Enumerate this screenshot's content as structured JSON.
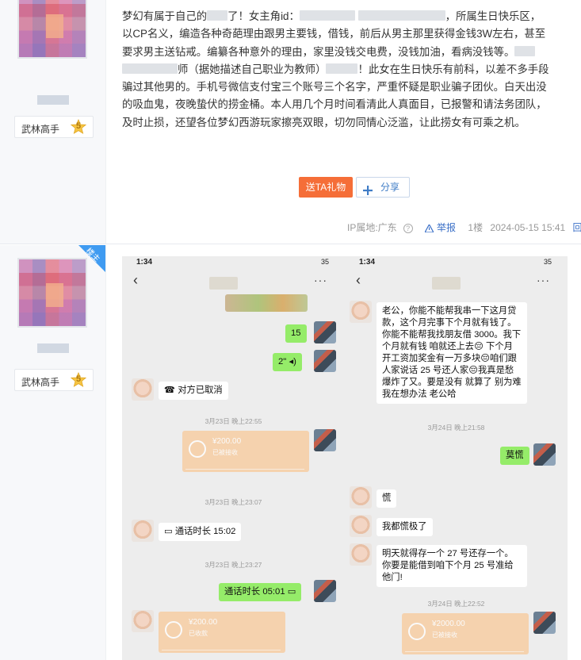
{
  "post1": {
    "user": {
      "badge_label": "武林高手",
      "level": "5"
    },
    "paragraph": "梦幻有属于自己的 了！女主角id： ，所属生日快乐区，以CP名义，编造各种奇葩理由跟男主要钱，借钱，前后从男主那里获得金钱3W左右，甚至要求男主送钻戒。编纂各种意外的理由，家里没钱交电费，没钱加油，看病没钱等。 师（据她描述自己职业为教师） ！此女在生日快乐有前科，以差不多手段骗过其他男的。手机号微信支付宝三个账号三个名字，严重怀疑是职业骗子团伙。白天出没的吸血鬼，夜晚蛰伏的捞金桶。本人用几个月时间看清此人真面目，已报警和请法务团队，及时止损，还望各位梦幻西游玩家擦亮双眼，切勿同情心泛滥，让此捞女有可乘之机。",
    "text": {
      "l1a": "梦幻有属于自己的",
      "l1b": "了！女主角id：",
      "l1c": "，所属生日快乐区，",
      "l2": "以CP名义，编造各种奇葩理由跟男主要钱，借钱，前后从男主那里获得金钱3W左右，甚至",
      "l3": "要求男主送钻戒。编纂各种意外的理由，家里没钱交电费，没钱加油，看病没钱等。",
      "l4a": "师（据她描述自己职业为教师）",
      "l4b": "！此女在生日快乐有前科，以差不多手段",
      "l5": "骗过其他男的。手机号微信支付宝三个账号三个名字，严重怀疑是职业骗子团伙。白天出没",
      "l6": "的吸血鬼，夜晚蛰伏的捞金桶。本人用几个月时间看清此人真面目，已报警和请法务团队，",
      "l7": "及时止损，还望各位梦幻西游玩家擦亮双眼，切勿同情心泛滥，让此捞女有可乘之机。"
    },
    "gift_button": "送TA礼物",
    "share_button": "分享",
    "meta": {
      "ip": "IP属地:广东",
      "report": "举报",
      "floor": "1楼",
      "datetime": "2024-05-15 15:41",
      "reply": "回复"
    }
  },
  "post2": {
    "user": {
      "badge_label": "武林高手",
      "level": "5",
      "corner_tag": "楼主"
    },
    "left_chat": {
      "status_time": "1:34",
      "battery": "35",
      "msg_15": "15",
      "msg_voice": "2\"",
      "msg_cancel": "对方已取消",
      "ts1": "3月23日 晚上22:55",
      "pay1_amount": "¥200.00",
      "pay1_status": "已被接收",
      "ts2": "3月23日 晚上23:07",
      "call1": "通话时长 15:02",
      "ts3": "3月23日 晚上23:27",
      "call2": "通话时长 05:01",
      "pay2_amount": "¥200.00",
      "pay2_status": "已收款"
    },
    "right_chat": {
      "status_time": "1:34",
      "battery": "35",
      "msg_long": "老公，你能不能帮我串一下这月贷款，这个月完事下个月就有钱了。你能不能帮我找朋友借 3000。我下个月就有钱 咱就还上去😔 下个月开工资加奖金有一万多块😔咱们跟人家说话 25 号还人家😔我真是愁爆炸了又。要是没有 就算了 别为难 我在想办法 老公哈",
      "ts1": "3月24日 晚上21:58",
      "msg_reply": "莫慌",
      "msg_huang": "慌",
      "msg_huangji": "我都慌极了",
      "msg_27": "明天就得存一个 27 号还存一个。你要是能借到咱下个月 25 号准给他门!",
      "ts2": "3月24日 晚上22:52",
      "pay_amount": "¥2000.00",
      "pay_status": "已被接收"
    }
  }
}
